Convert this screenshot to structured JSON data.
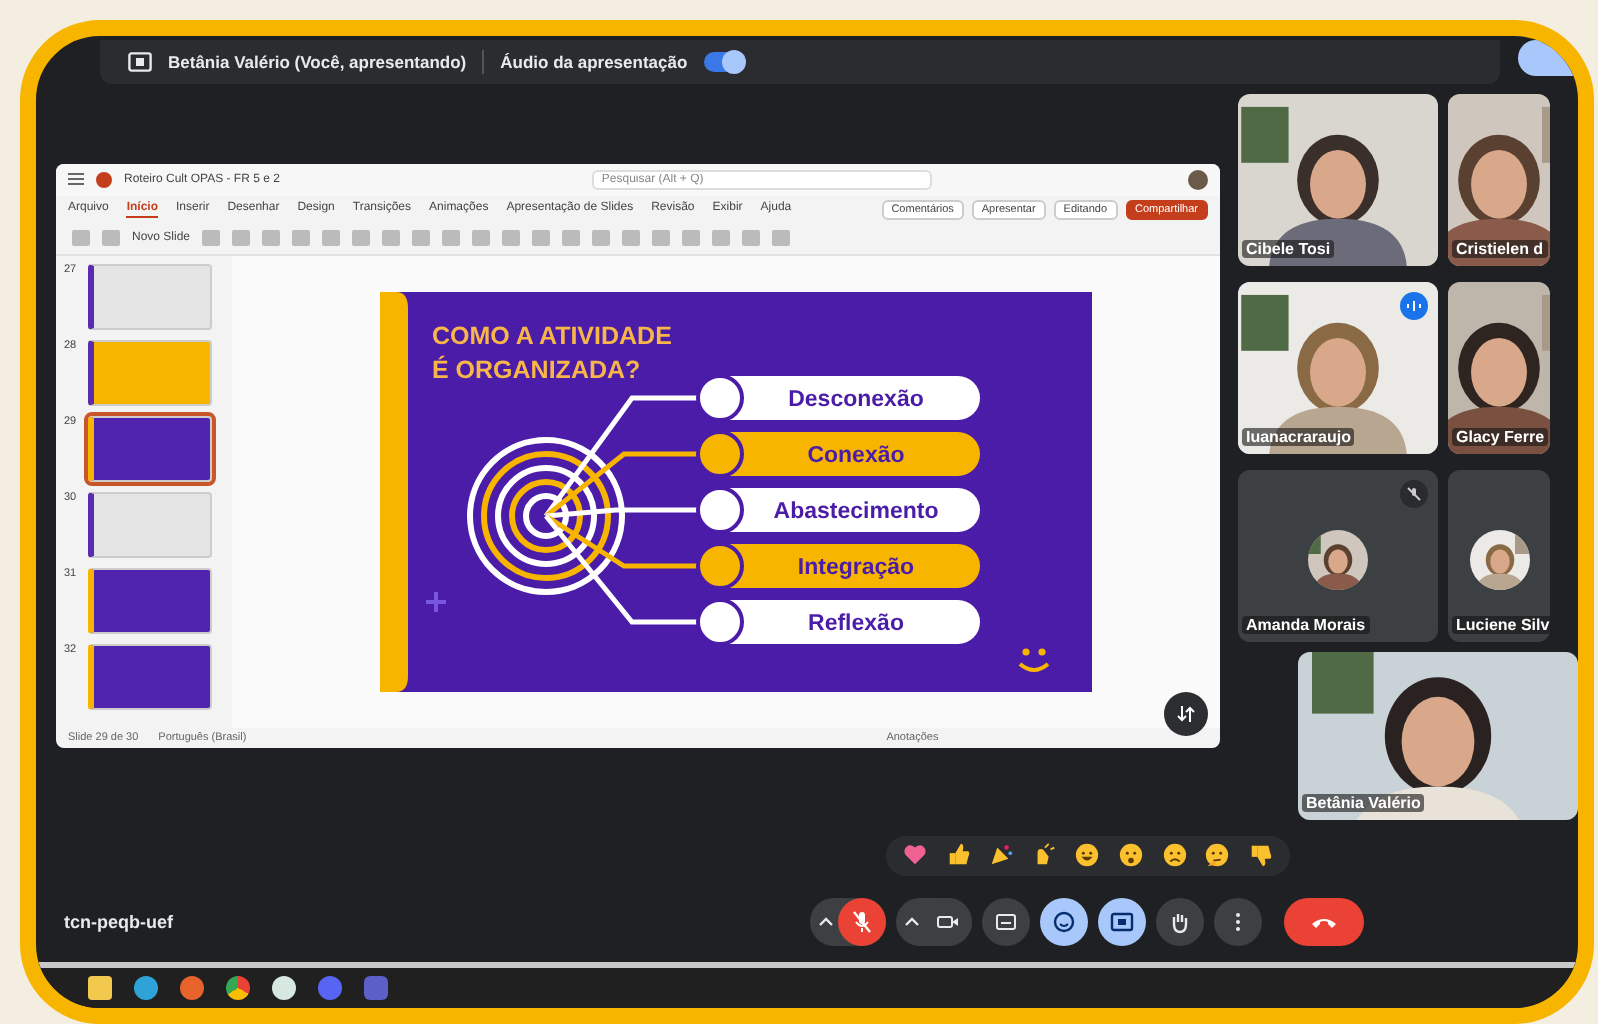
{
  "presenter_bar": {
    "presenter": "Betânia Valério (Você, apresentando)",
    "audio_label": "Áudio da apresentação",
    "audio_on": true
  },
  "shared_window": {
    "title": "Roteiro Cult OPAS - FR 5 e 2",
    "search_placeholder": "Pesquisar (Alt + Q)",
    "ribbon_tabs": [
      {
        "label": "Arquivo",
        "selected": false
      },
      {
        "label": "Início",
        "selected": true
      },
      {
        "label": "Inserir",
        "selected": false
      },
      {
        "label": "Desenhar",
        "selected": false
      },
      {
        "label": "Design",
        "selected": false
      },
      {
        "label": "Transições",
        "selected": false
      },
      {
        "label": "Animações",
        "selected": false
      },
      {
        "label": "Apresentação de Slides",
        "selected": false
      },
      {
        "label": "Revisão",
        "selected": false
      },
      {
        "label": "Exibir",
        "selected": false
      },
      {
        "label": "Ajuda",
        "selected": false
      }
    ],
    "ribbon_buttons": [
      {
        "label": "Comentários",
        "kind": "plain"
      },
      {
        "label": "Apresentar",
        "kind": "plain"
      },
      {
        "label": "Editando",
        "kind": "plain"
      },
      {
        "label": "Compartilhar",
        "kind": "primary"
      }
    ],
    "new_slide": "Novo Slide",
    "thumbnails": [
      {
        "number": "27",
        "kind": "gray",
        "selected": false
      },
      {
        "number": "28",
        "kind": "yellow",
        "selected": false
      },
      {
        "number": "29",
        "kind": "purple",
        "selected": true
      },
      {
        "number": "30",
        "kind": "gray",
        "selected": false
      },
      {
        "number": "31",
        "kind": "purple",
        "selected": false
      },
      {
        "number": "32",
        "kind": "purple",
        "selected": false
      }
    ],
    "slide": {
      "title_lines": [
        "COMO A ATIVIDADE",
        "É ORGANIZADA?"
      ],
      "items": [
        {
          "label": "Desconexão",
          "kind": "white"
        },
        {
          "label": "Conexão",
          "kind": "yellow"
        },
        {
          "label": "Abastecimento",
          "kind": "white"
        },
        {
          "label": "Integração",
          "kind": "yellow"
        },
        {
          "label": "Reflexão",
          "kind": "white"
        }
      ]
    },
    "status": {
      "slide_counter": "Slide 29 de 30",
      "language": "Português (Brasil)",
      "notes": "Anotações"
    }
  },
  "participants": [
    {
      "name": "Cibele Tosi",
      "kind": "video",
      "speaking": false,
      "muted": false
    },
    {
      "name": "Cristielen d",
      "kind": "video",
      "speaking": false,
      "muted": false
    },
    {
      "name": "Iuanacraraujo",
      "kind": "video",
      "speaking": true,
      "muted": false
    },
    {
      "name": "Glacy Ferre",
      "kind": "video",
      "speaking": false,
      "muted": false
    },
    {
      "name": "Amanda Morais",
      "kind": "avatar",
      "speaking": false,
      "muted": true
    },
    {
      "name": "Luciene Silv",
      "kind": "avatar",
      "speaking": false,
      "muted": false
    }
  ],
  "self_tile": {
    "name": "Betânia Valério"
  },
  "reactions": [
    {
      "kind": "heart"
    },
    {
      "kind": "thumbs_up"
    },
    {
      "kind": "party"
    },
    {
      "kind": "clap"
    },
    {
      "kind": "laugh"
    },
    {
      "kind": "surprised"
    },
    {
      "kind": "sad"
    },
    {
      "kind": "thinking"
    },
    {
      "kind": "thumbs_down"
    }
  ],
  "meeting_code": "tcn-peqb-uef",
  "controls": [
    {
      "kind": "mic",
      "on": false
    },
    {
      "kind": "camera",
      "on": true
    },
    {
      "kind": "captions",
      "active": false
    },
    {
      "kind": "emoji",
      "active": true
    },
    {
      "kind": "present",
      "active": true
    },
    {
      "kind": "hand",
      "active": false
    },
    {
      "kind": "more"
    },
    {
      "kind": "end"
    }
  ]
}
